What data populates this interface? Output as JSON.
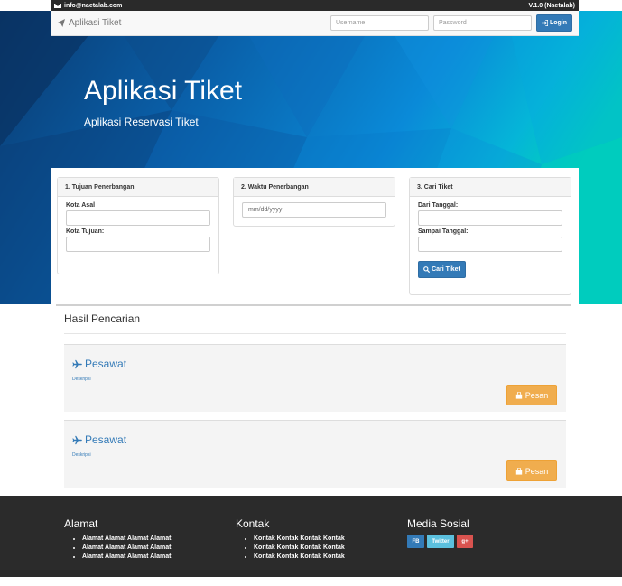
{
  "topbar": {
    "email": "info@naetalab.com",
    "version": "V.1.0 (Naetalab)"
  },
  "navbar": {
    "brand": "Aplikasi Tiket",
    "username_placeholder": "Username",
    "password_placeholder": "Password",
    "login_label": "Login"
  },
  "hero": {
    "title": "Aplikasi Tiket",
    "subtitle": "Aplikasi Reservasi Tiket",
    "colors": {
      "dark": "#0a3f7a",
      "mid": "#0a78c8",
      "teal": "#00c9c0"
    }
  },
  "search": {
    "panel1": {
      "heading": "1. Tujuan Penerbangan",
      "origin_label": "Kota Asal",
      "origin_value": "",
      "dest_label": "Kota Tujuan:",
      "dest_value": ""
    },
    "panel2": {
      "heading": "2. Waktu Penerbangan",
      "date_placeholder": "mm/dd/yyyy"
    },
    "panel3": {
      "heading": "3. Cari Tiket",
      "from_label": "Dari Tanggal:",
      "to_label": "Sampai Tanggal:",
      "button": "Cari Tiket"
    }
  },
  "results": {
    "title": "Hasil Pencarian",
    "items": [
      {
        "name": "Pesawat",
        "desc": "Deskripsi",
        "button": "Pesan"
      },
      {
        "name": "Pesawat",
        "desc": "Deskripsi",
        "button": "Pesan"
      }
    ]
  },
  "footer": {
    "alamat": {
      "title": "Alamat",
      "items": [
        "Alamat Alamat Alamat Alamat",
        "Alamat Alamat Alamat Alamat",
        "Alamat Alamat Alamat Alamat"
      ]
    },
    "kontak": {
      "title": "Kontak",
      "items": [
        "Kontak Kontak Kontak Kontak",
        "Kontak Kontak Kontak Kontak",
        "Kontak Kontak Kontak Kontak"
      ]
    },
    "sosial": {
      "title": "Media Sosial",
      "buttons": [
        {
          "label": "FB",
          "color": "#337ab7"
        },
        {
          "label": "Twitter",
          "color": "#5bc0de"
        },
        {
          "label": "g+",
          "color": "#d9534f"
        }
      ]
    }
  }
}
